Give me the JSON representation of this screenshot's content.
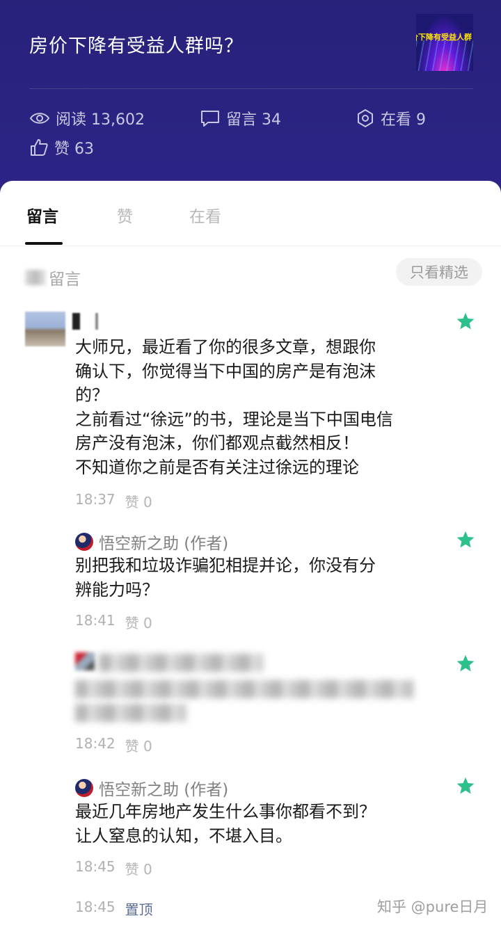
{
  "article": {
    "title": "房价下降有受益人群吗？",
    "thumb_text": "价下降有受益人群",
    "stats": {
      "read": "阅读 13,602",
      "comments": "留言 34",
      "watching": "在看 9",
      "likes": "赞 63"
    }
  },
  "tabs": [
    {
      "label": "留言"
    },
    {
      "label": "赞"
    },
    {
      "label": "在看"
    }
  ],
  "section": {
    "label": "留言",
    "filter_button": "只看精选"
  },
  "comments": [
    {
      "text": "大师兄，最近看了你的很多文章，想跟你\n确认下，你觉得当下中国的房产是有泡沫\n的？\n之前看过“徐远”的书，理论是当下中国电信\n房产没有泡沫，你们都观点截然相反！\n不知道你之前是否有关注过徐远的理论",
      "time": "18:37",
      "likes": "赞 0"
    },
    {
      "author": "悟空新之助 (作者)",
      "text": "别把我和垃圾诈骗犯相提并论，你没有分\n辨能力吗？",
      "time": "18:41",
      "likes": "赞 0"
    },
    {
      "time": "18:42",
      "likes": "赞 0"
    },
    {
      "author": "悟空新之助 (作者)",
      "text": "最近几年房地产发生什么事你都看不到？\n让人窒息的认知，不堪入目。",
      "time": "18:45",
      "likes": "赞 0"
    }
  ],
  "footer": {
    "time": "18:45",
    "pin_label": "置顶",
    "watermark": "知乎 @pure日月"
  },
  "colors": {
    "header_bg": "#2a2380",
    "star": "#2ec08a",
    "pin_link": "#5b6d99"
  }
}
